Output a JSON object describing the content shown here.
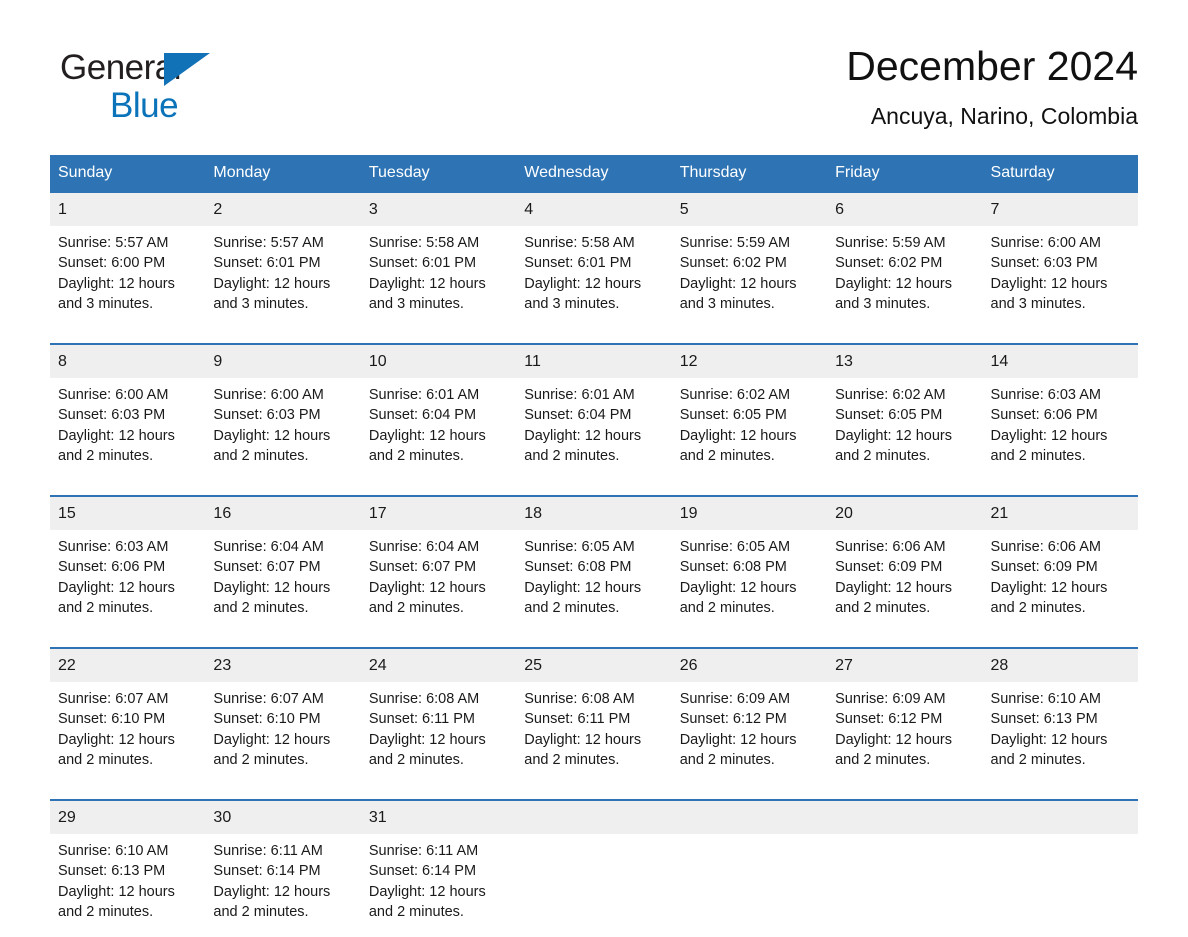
{
  "brand": {
    "name_part1": "General",
    "name_part2": "Blue",
    "triangle_color": "#1272b8",
    "blue_color": "#0b73ba"
  },
  "header": {
    "title": "December 2024",
    "subtitle": "Ancuya, Narino, Colombia",
    "accent_color": "#2e74b5",
    "daynum_bg": "#efefef"
  },
  "calendar": {
    "weekday_headers": [
      "Sunday",
      "Monday",
      "Tuesday",
      "Wednesday",
      "Thursday",
      "Friday",
      "Saturday"
    ],
    "weeks": [
      [
        {
          "day": "1",
          "sunrise": "Sunrise: 5:57 AM",
          "sunset": "Sunset: 6:00 PM",
          "daylight_line1": "Daylight: 12 hours",
          "daylight_line2": "and 3 minutes."
        },
        {
          "day": "2",
          "sunrise": "Sunrise: 5:57 AM",
          "sunset": "Sunset: 6:01 PM",
          "daylight_line1": "Daylight: 12 hours",
          "daylight_line2": "and 3 minutes."
        },
        {
          "day": "3",
          "sunrise": "Sunrise: 5:58 AM",
          "sunset": "Sunset: 6:01 PM",
          "daylight_line1": "Daylight: 12 hours",
          "daylight_line2": "and 3 minutes."
        },
        {
          "day": "4",
          "sunrise": "Sunrise: 5:58 AM",
          "sunset": "Sunset: 6:01 PM",
          "daylight_line1": "Daylight: 12 hours",
          "daylight_line2": "and 3 minutes."
        },
        {
          "day": "5",
          "sunrise": "Sunrise: 5:59 AM",
          "sunset": "Sunset: 6:02 PM",
          "daylight_line1": "Daylight: 12 hours",
          "daylight_line2": "and 3 minutes."
        },
        {
          "day": "6",
          "sunrise": "Sunrise: 5:59 AM",
          "sunset": "Sunset: 6:02 PM",
          "daylight_line1": "Daylight: 12 hours",
          "daylight_line2": "and 3 minutes."
        },
        {
          "day": "7",
          "sunrise": "Sunrise: 6:00 AM",
          "sunset": "Sunset: 6:03 PM",
          "daylight_line1": "Daylight: 12 hours",
          "daylight_line2": "and 3 minutes."
        }
      ],
      [
        {
          "day": "8",
          "sunrise": "Sunrise: 6:00 AM",
          "sunset": "Sunset: 6:03 PM",
          "daylight_line1": "Daylight: 12 hours",
          "daylight_line2": "and 2 minutes."
        },
        {
          "day": "9",
          "sunrise": "Sunrise: 6:00 AM",
          "sunset": "Sunset: 6:03 PM",
          "daylight_line1": "Daylight: 12 hours",
          "daylight_line2": "and 2 minutes."
        },
        {
          "day": "10",
          "sunrise": "Sunrise: 6:01 AM",
          "sunset": "Sunset: 6:04 PM",
          "daylight_line1": "Daylight: 12 hours",
          "daylight_line2": "and 2 minutes."
        },
        {
          "day": "11",
          "sunrise": "Sunrise: 6:01 AM",
          "sunset": "Sunset: 6:04 PM",
          "daylight_line1": "Daylight: 12 hours",
          "daylight_line2": "and 2 minutes."
        },
        {
          "day": "12",
          "sunrise": "Sunrise: 6:02 AM",
          "sunset": "Sunset: 6:05 PM",
          "daylight_line1": "Daylight: 12 hours",
          "daylight_line2": "and 2 minutes."
        },
        {
          "day": "13",
          "sunrise": "Sunrise: 6:02 AM",
          "sunset": "Sunset: 6:05 PM",
          "daylight_line1": "Daylight: 12 hours",
          "daylight_line2": "and 2 minutes."
        },
        {
          "day": "14",
          "sunrise": "Sunrise: 6:03 AM",
          "sunset": "Sunset: 6:06 PM",
          "daylight_line1": "Daylight: 12 hours",
          "daylight_line2": "and 2 minutes."
        }
      ],
      [
        {
          "day": "15",
          "sunrise": "Sunrise: 6:03 AM",
          "sunset": "Sunset: 6:06 PM",
          "daylight_line1": "Daylight: 12 hours",
          "daylight_line2": "and 2 minutes."
        },
        {
          "day": "16",
          "sunrise": "Sunrise: 6:04 AM",
          "sunset": "Sunset: 6:07 PM",
          "daylight_line1": "Daylight: 12 hours",
          "daylight_line2": "and 2 minutes."
        },
        {
          "day": "17",
          "sunrise": "Sunrise: 6:04 AM",
          "sunset": "Sunset: 6:07 PM",
          "daylight_line1": "Daylight: 12 hours",
          "daylight_line2": "and 2 minutes."
        },
        {
          "day": "18",
          "sunrise": "Sunrise: 6:05 AM",
          "sunset": "Sunset: 6:08 PM",
          "daylight_line1": "Daylight: 12 hours",
          "daylight_line2": "and 2 minutes."
        },
        {
          "day": "19",
          "sunrise": "Sunrise: 6:05 AM",
          "sunset": "Sunset: 6:08 PM",
          "daylight_line1": "Daylight: 12 hours",
          "daylight_line2": "and 2 minutes."
        },
        {
          "day": "20",
          "sunrise": "Sunrise: 6:06 AM",
          "sunset": "Sunset: 6:09 PM",
          "daylight_line1": "Daylight: 12 hours",
          "daylight_line2": "and 2 minutes."
        },
        {
          "day": "21",
          "sunrise": "Sunrise: 6:06 AM",
          "sunset": "Sunset: 6:09 PM",
          "daylight_line1": "Daylight: 12 hours",
          "daylight_line2": "and 2 minutes."
        }
      ],
      [
        {
          "day": "22",
          "sunrise": "Sunrise: 6:07 AM",
          "sunset": "Sunset: 6:10 PM",
          "daylight_line1": "Daylight: 12 hours",
          "daylight_line2": "and 2 minutes."
        },
        {
          "day": "23",
          "sunrise": "Sunrise: 6:07 AM",
          "sunset": "Sunset: 6:10 PM",
          "daylight_line1": "Daylight: 12 hours",
          "daylight_line2": "and 2 minutes."
        },
        {
          "day": "24",
          "sunrise": "Sunrise: 6:08 AM",
          "sunset": "Sunset: 6:11 PM",
          "daylight_line1": "Daylight: 12 hours",
          "daylight_line2": "and 2 minutes."
        },
        {
          "day": "25",
          "sunrise": "Sunrise: 6:08 AM",
          "sunset": "Sunset: 6:11 PM",
          "daylight_line1": "Daylight: 12 hours",
          "daylight_line2": "and 2 minutes."
        },
        {
          "day": "26",
          "sunrise": "Sunrise: 6:09 AM",
          "sunset": "Sunset: 6:12 PM",
          "daylight_line1": "Daylight: 12 hours",
          "daylight_line2": "and 2 minutes."
        },
        {
          "day": "27",
          "sunrise": "Sunrise: 6:09 AM",
          "sunset": "Sunset: 6:12 PM",
          "daylight_line1": "Daylight: 12 hours",
          "daylight_line2": "and 2 minutes."
        },
        {
          "day": "28",
          "sunrise": "Sunrise: 6:10 AM",
          "sunset": "Sunset: 6:13 PM",
          "daylight_line1": "Daylight: 12 hours",
          "daylight_line2": "and 2 minutes."
        }
      ],
      [
        {
          "day": "29",
          "sunrise": "Sunrise: 6:10 AM",
          "sunset": "Sunset: 6:13 PM",
          "daylight_line1": "Daylight: 12 hours",
          "daylight_line2": "and 2 minutes."
        },
        {
          "day": "30",
          "sunrise": "Sunrise: 6:11 AM",
          "sunset": "Sunset: 6:14 PM",
          "daylight_line1": "Daylight: 12 hours",
          "daylight_line2": "and 2 minutes."
        },
        {
          "day": "31",
          "sunrise": "Sunrise: 6:11 AM",
          "sunset": "Sunset: 6:14 PM",
          "daylight_line1": "Daylight: 12 hours",
          "daylight_line2": "and 2 minutes."
        },
        {
          "day": "",
          "sunrise": "",
          "sunset": "",
          "daylight_line1": "",
          "daylight_line2": ""
        },
        {
          "day": "",
          "sunrise": "",
          "sunset": "",
          "daylight_line1": "",
          "daylight_line2": ""
        },
        {
          "day": "",
          "sunrise": "",
          "sunset": "",
          "daylight_line1": "",
          "daylight_line2": ""
        },
        {
          "day": "",
          "sunrise": "",
          "sunset": "",
          "daylight_line1": "",
          "daylight_line2": ""
        }
      ]
    ]
  }
}
